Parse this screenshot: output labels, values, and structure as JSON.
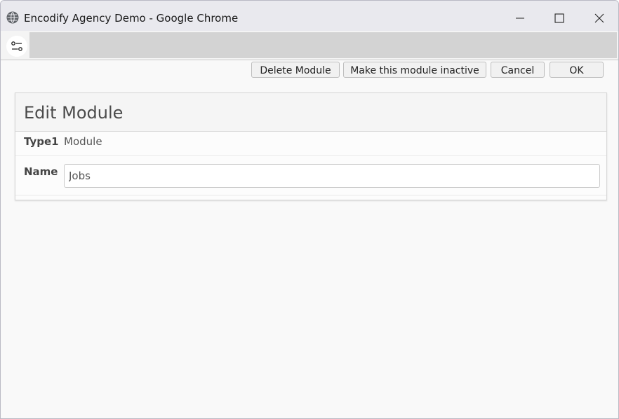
{
  "window": {
    "title": "Encodify Agency Demo - Google Chrome"
  },
  "toolbar": {
    "icon": "tune-icon"
  },
  "actions": {
    "delete_label": "Delete Module",
    "inactive_label": "Make this module inactive",
    "cancel_label": "Cancel",
    "ok_label": "OK"
  },
  "panel": {
    "title": "Edit Module",
    "fields": {
      "type_label": "Type1",
      "type_value": "Module",
      "name_label": "Name",
      "name_value": "Jobs"
    }
  }
}
